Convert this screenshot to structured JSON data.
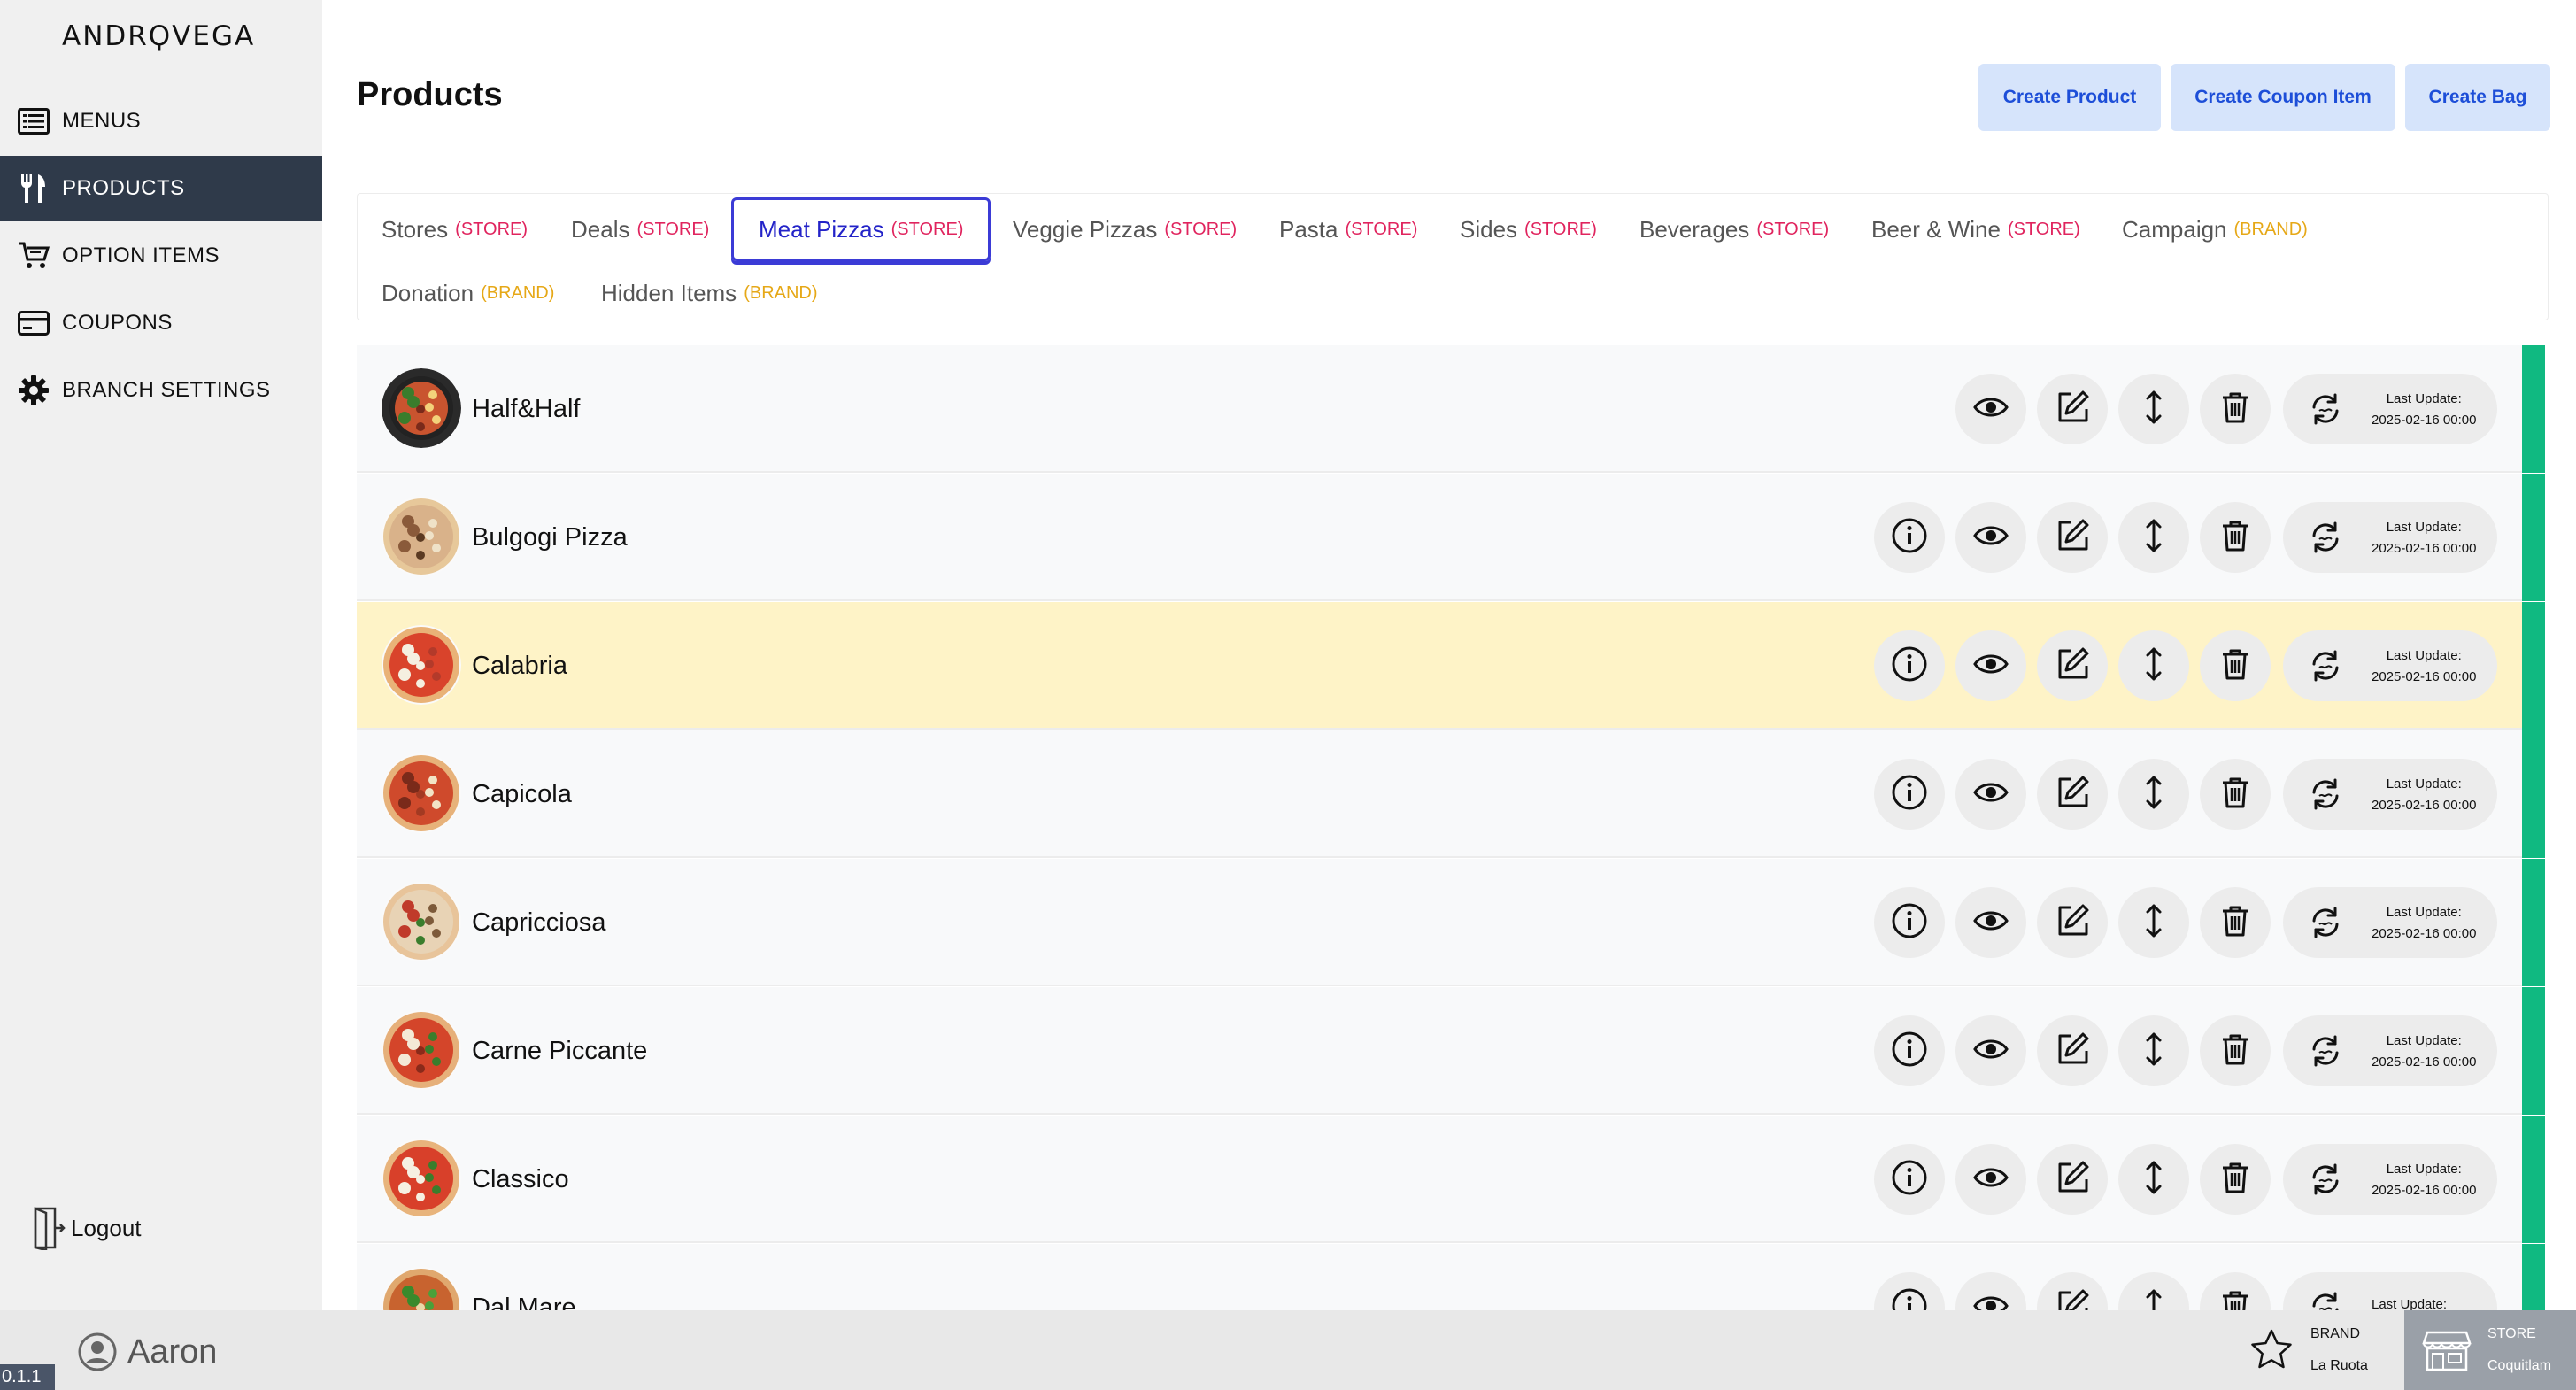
{
  "app": {
    "logo": "ANDRϘVEGA"
  },
  "sidebar": {
    "items": [
      {
        "label": "MENUS",
        "icon": "menu-list-icon",
        "active": false
      },
      {
        "label": "PRODUCTS",
        "icon": "fork-knife-icon",
        "active": true
      },
      {
        "label": "OPTION ITEMS",
        "icon": "cart-icon",
        "active": false
      },
      {
        "label": "COUPONS",
        "icon": "card-icon",
        "active": false
      },
      {
        "label": "BRANCH SETTINGS",
        "icon": "gear-icon",
        "active": false
      }
    ],
    "logout": "Logout"
  },
  "header": {
    "title": "Products",
    "buttons": {
      "create_product": "Create Product",
      "create_coupon": "Create Coupon Item",
      "create_bag": "Create Bag"
    }
  },
  "tabs": [
    {
      "label": "Stores",
      "tag": "(STORE)"
    },
    {
      "label": "Deals",
      "tag": "(STORE)"
    },
    {
      "label": "Meat Pizzas",
      "tag": "(STORE)"
    },
    {
      "label": "Veggie Pizzas",
      "tag": "(STORE)"
    },
    {
      "label": "Pasta",
      "tag": "(STORE)"
    },
    {
      "label": "Sides",
      "tag": "(STORE)"
    },
    {
      "label": "Beverages",
      "tag": "(STORE)"
    },
    {
      "label": "Beer & Wine",
      "tag": "(STORE)"
    },
    {
      "label": "Campaign",
      "tag": "(BRAND)"
    },
    {
      "label": "Donation",
      "tag": "(BRAND)"
    },
    {
      "label": "Hidden Items",
      "tag": "(BRAND)"
    }
  ],
  "products": [
    {
      "name": "Half&Half",
      "update_label": "Last Update:",
      "update_date": "2025-02-16 00:00"
    },
    {
      "name": "Bulgogi Pizza",
      "update_label": "Last Update:",
      "update_date": "2025-02-16 00:00"
    },
    {
      "name": "Calabria",
      "update_label": "Last Update:",
      "update_date": "2025-02-16 00:00"
    },
    {
      "name": "Capicola",
      "update_label": "Last Update:",
      "update_date": "2025-02-16 00:00"
    },
    {
      "name": "Capricciosa",
      "update_label": "Last Update:",
      "update_date": "2025-02-16 00:00"
    },
    {
      "name": "Carne Piccante",
      "update_label": "Last Update:",
      "update_date": "2025-02-16 00:00"
    },
    {
      "name": "Classico",
      "update_label": "Last Update:",
      "update_date": "2025-02-16 00:00"
    },
    {
      "name": "Dal Mare",
      "update_label": "Last Update:",
      "update_date": ""
    }
  ],
  "footer": {
    "version": "0.1.1",
    "user": "Aaron",
    "brand_label": "BRAND",
    "brand_value": "La Ruota",
    "store_label": "STORE",
    "store_value": "Coquitlam"
  },
  "colors": {
    "sidebar_active": "#2f3a4a",
    "accent": "#3b3bd6",
    "status_bar": "#10b981",
    "highlight_row": "#fef3c7"
  }
}
